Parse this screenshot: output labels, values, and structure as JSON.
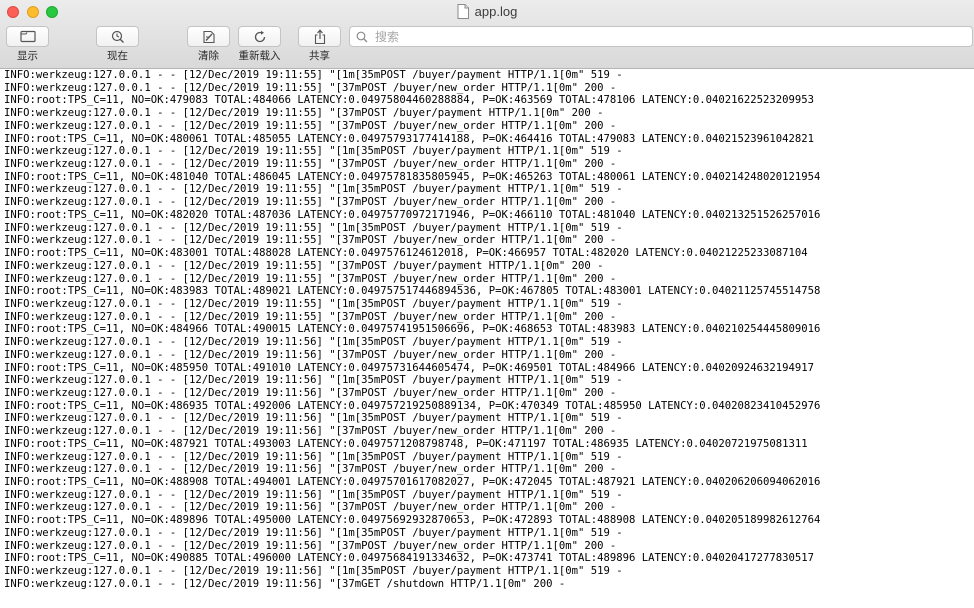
{
  "window": {
    "title": "app.log"
  },
  "toolbar": {
    "show_label": "显示",
    "now_label": "现在",
    "clear_label": "清除",
    "reload_label": "重新载入",
    "share_label": "共享"
  },
  "search": {
    "placeholder": "搜索",
    "value": ""
  },
  "icons": {
    "show": "sidebar-icon",
    "now": "jump-to-now-icon",
    "clear": "clear-icon",
    "reload": "reload-icon",
    "share": "share-icon",
    "search": "magnifier-icon",
    "document": "document-icon"
  },
  "colors": {
    "close": "#fc5f57",
    "minimize": "#fdbc2e",
    "zoom": "#28c840"
  },
  "log": {
    "lines": [
      "INFO:werkzeug:127.0.0.1 - - [12/Dec/2019 19:11:55] \"[1m[35mPOST /buyer/payment HTTP/1.1[0m\" 519 -",
      "INFO:werkzeug:127.0.0.1 - - [12/Dec/2019 19:11:55] \"[37mPOST /buyer/new_order HTTP/1.1[0m\" 200 -",
      "INFO:root:TPS_C=11, NO=OK:479083 TOTAL:484066 LATENCY:0.04975804460288884, P=OK:463569 TOTAL:478106 LATENCY:0.04021622523209953",
      "INFO:werkzeug:127.0.0.1 - - [12/Dec/2019 19:11:55] \"[37mPOST /buyer/payment HTTP/1.1[0m\" 200 -",
      "INFO:werkzeug:127.0.0.1 - - [12/Dec/2019 19:11:55] \"[37mPOST /buyer/new_order HTTP/1.1[0m\" 200 -",
      "INFO:root:TPS_C=11, NO=OK:480061 TOTAL:485055 LATENCY:0.04975793177414188, P=OK:464416 TOTAL:479083 LATENCY:0.04021523961042821",
      "INFO:werkzeug:127.0.0.1 - - [12/Dec/2019 19:11:55] \"[1m[35mPOST /buyer/payment HTTP/1.1[0m\" 519 -",
      "INFO:werkzeug:127.0.0.1 - - [12/Dec/2019 19:11:55] \"[37mPOST /buyer/new_order HTTP/1.1[0m\" 200 -",
      "INFO:root:TPS_C=11, NO=OK:481040 TOTAL:486045 LATENCY:0.04975781835805945, P=OK:465263 TOTAL:480061 LATENCY:0.04021424802012195​4",
      "INFO:werkzeug:127.0.0.1 - - [12/Dec/2019 19:11:55] \"[1m[35mPOST /buyer/payment HTTP/1.1[0m\" 519 -",
      "INFO:werkzeug:127.0.0.1 - - [12/Dec/2019 19:11:55] \"[37mPOST /buyer/new_order HTTP/1.1[0m\" 200 -",
      "INFO:root:TPS_C=11, NO=OK:482020 TOTAL:487036 LATENCY:0.04975770972171946, P=OK:466110 TOTAL:481040 LATENCY:0.04021325152625701​6",
      "INFO:werkzeug:127.0.0.1 - - [12/Dec/2019 19:11:55] \"[1m[35mPOST /buyer/payment HTTP/1.1[0m\" 519 -",
      "INFO:werkzeug:127.0.0.1 - - [12/Dec/2019 19:11:55] \"[37mPOST /buyer/new_order HTTP/1.1[0m\" 200 -",
      "INFO:root:TPS_C=11, NO=OK:483001 TOTAL:488028 LATENCY:0.04975761246120​18, P=OK:466957 TOTAL:482020 LATENCY:0.04021225233087104",
      "INFO:werkzeug:127.0.0.1 - - [12/Dec/2019 19:11:55] \"[37mPOST /buyer/payment HTTP/1.1[0m\" 200 -",
      "INFO:werkzeug:127.0.0.1 - - [12/Dec/2019 19:11:55] \"[37mPOST /buyer/new_order HTTP/1.1[0m\" 200 -",
      "INFO:root:TPS_C=11, NO=OK:483983 TOTAL:489021 LATENCY:0.04975751744689453​6, P=OK:467805 TOTAL:483001 LATENCY:0.04021125745514758",
      "INFO:werkzeug:127.0.0.1 - - [12/Dec/2019 19:11:55] \"[1m[35mPOST /buyer/payment HTTP/1.1[0m\" 519 -",
      "INFO:werkzeug:127.0.0.1 - - [12/Dec/2019 19:11:55] \"[37mPOST /buyer/new_order HTTP/1.1[0m\" 200 -",
      "INFO:root:TPS_C=11, NO=OK:484966 TOTAL:490015 LATENCY:0.04975741951506696, P=OK:468653 TOTAL:483983 LATENCY:0.04021025444580901​6",
      "INFO:werkzeug:127.0.0.1 - - [12/Dec/2019 19:11:56] \"[1m[35mPOST /buyer/payment HTTP/1.1[0m\" 519 -",
      "INFO:werkzeug:127.0.0.1 - - [12/Dec/2019 19:11:56] \"[37mPOST /buyer/new_order HTTP/1.1[0m\" 200 -",
      "INFO:root:TPS_C=11, NO=OK:485950 TOTAL:491010 LATENCY:0.04975731644605474, P=OK:469501 TOTAL:484966 LATENCY:0.04020924632194917",
      "INFO:werkzeug:127.0.0.1 - - [12/Dec/2019 19:11:56] \"[1m[35mPOST /buyer/payment HTTP/1.1[0m\" 519 -",
      "INFO:werkzeug:127.0.0.1 - - [12/Dec/2019 19:11:56] \"[37mPOST /buyer/new_order HTTP/1.1[0m\" 200 -",
      "INFO:root:TPS_C=11, NO=OK:486935 TOTAL:492006 LATENCY:0.04975721925088913​4, P=OK:470349 TOTAL:485950 LATENCY:0.04020823410452976",
      "INFO:werkzeug:127.0.0.1 - - [12/Dec/2019 19:11:56] \"[1m[35mPOST /buyer/payment HTTP/1.1[0m\" 519 -",
      "INFO:werkzeug:127.0.0.1 - - [12/Dec/2019 19:11:56] \"[37mPOST /buyer/new_order HTTP/1.1[0m\" 200 -",
      "INFO:root:TPS_C=11, NO=OK:487921 TOTAL:493003 LATENCY:0.04975712087987​48, P=OK:471197 TOTAL:486935 LATENCY:0.04020721975081311",
      "INFO:werkzeug:127.0.0.1 - - [12/Dec/2019 19:11:56] \"[1m[35mPOST /buyer/payment HTTP/1.1[0m\" 519 -",
      "INFO:werkzeug:127.0.0.1 - - [12/Dec/2019 19:11:56] \"[37mPOST /buyer/new_order HTTP/1.1[0m\" 200 -",
      "INFO:root:TPS_C=11, NO=OK:488908 TOTAL:494001 LATENCY:0.04975701617082027, P=OK:472045 TOTAL:487921 LATENCY:0.04020620609406201​6",
      "INFO:werkzeug:127.0.0.1 - - [12/Dec/2019 19:11:56] \"[1m[35mPOST /buyer/payment HTTP/1.1[0m\" 519 -",
      "INFO:werkzeug:127.0.0.1 - - [12/Dec/2019 19:11:56] \"[37mPOST /buyer/new_order HTTP/1.1[0m\" 200 -",
      "INFO:root:TPS_C=11, NO=OK:489896 TOTAL:495000 LATENCY:0.04975692932870653, P=OK:472893 TOTAL:488908 LATENCY:0.04020518998261276​4",
      "INFO:werkzeug:127.0.0.1 - - [12/Dec/2019 19:11:56] \"[1m[35mPOST /buyer/payment HTTP/1.1[0m\" 519 -",
      "INFO:werkzeug:127.0.0.1 - - [12/Dec/2019 19:11:56] \"[37mPOST /buyer/new_order HTTP/1.1[0m\" 200 -",
      "INFO:root:TPS_C=11, NO=OK:490885 TOTAL:496000 LATENCY:0.04975684191334632, P=OK:473741 TOTAL:489896 LATENCY:0.04020417277830517",
      "INFO:werkzeug:127.0.0.1 - - [12/Dec/2019 19:11:56] \"[1m[35mPOST /buyer/payment HTTP/1.1[0m\" 519 -",
      "INFO:werkzeug:127.0.0.1 - - [12/Dec/2019 19:11:56] \"[37mGET /shutdown HTTP/1.1[0m\" 200 -"
    ]
  }
}
